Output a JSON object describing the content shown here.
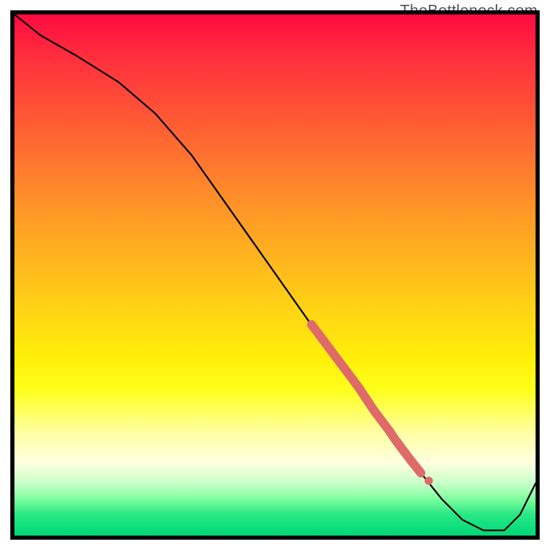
{
  "watermark": "TheBottleneck.com",
  "chart_data": {
    "type": "line",
    "title": "",
    "xlabel": "",
    "ylabel": "",
    "xlim": [
      0,
      100
    ],
    "ylim": [
      0,
      100
    ],
    "description": "Bottleneck percentage curve over normalized axis; vertical gradient red (high) to green (low). Black line descends from top-left, flattens near bottom-right at zero, then rises at far right. Pink highlighted segment marks a range on the descending portion.",
    "series": [
      {
        "name": "bottleneck-curve",
        "x": [
          0,
          5,
          12,
          20,
          27,
          34,
          46,
          58,
          66,
          72,
          78,
          82,
          86,
          90,
          94,
          97,
          100
        ],
        "y": [
          100,
          96,
          92,
          87,
          81,
          73,
          56,
          39,
          28,
          20,
          12,
          7,
          3,
          1,
          1,
          4,
          10
        ]
      }
    ],
    "highlight_segment": {
      "name": "marker-band",
      "x": [
        57,
        60,
        63,
        66,
        69,
        72,
        73,
        76,
        78
      ],
      "y": [
        40.5,
        36.5,
        32.5,
        28.5,
        24.0,
        20.0,
        18.5,
        14.5,
        12.0
      ],
      "color": "#de6a6a"
    },
    "highlight_dots": {
      "name": "marker-dots",
      "x": [
        73.5,
        79.5
      ],
      "y": [
        18.0,
        10.5
      ],
      "color": "#de6a6a"
    }
  }
}
